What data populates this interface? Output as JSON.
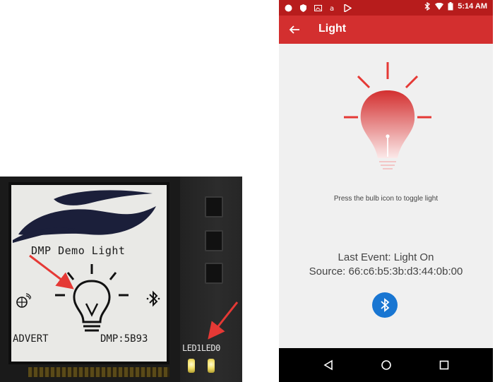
{
  "board": {
    "lcd_title": "DMP Demo Light",
    "advert_label": "ADVERT",
    "dmp_label": "DMP:5B93",
    "led_labels": "LED1LED0"
  },
  "phone": {
    "status_time": "5:14 AM",
    "app_title": "Light",
    "hint": "Press the bulb icon to toggle light",
    "last_event": "Last Event: Light On",
    "source": "Source: 66:c6:b5:3b:d3:44:0b:00"
  },
  "colors": {
    "status_bar": "#b71c1c",
    "app_bar": "#d32f2f",
    "bulb_top": "#d32f2f",
    "bulb_bottom": "#fbe9e9",
    "bluetooth_fab": "#1976d2",
    "arrow": "#e53935"
  },
  "icons": {
    "back": "arrow-left-icon",
    "bulb": "light-bulb-icon",
    "bluetooth": "bluetooth-icon",
    "nav": [
      "back-triangle-icon",
      "home-circle-icon",
      "recents-square-icon"
    ]
  }
}
